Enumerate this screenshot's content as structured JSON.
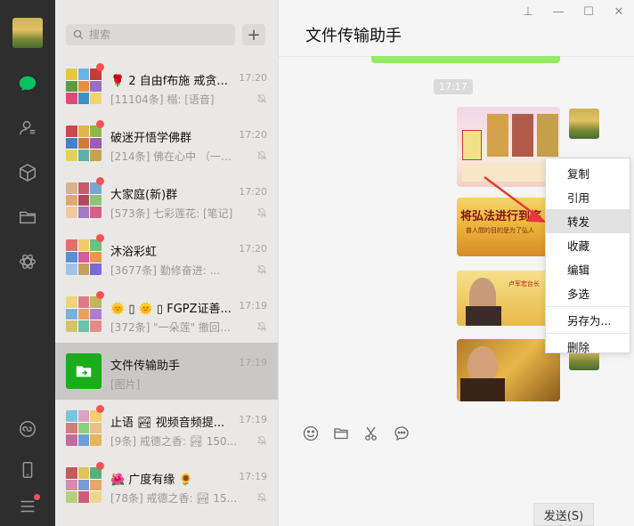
{
  "rail": {
    "icons": [
      "chat-icon",
      "contacts-icon",
      "favorites-icon",
      "files-icon",
      "moments-icon",
      "miniprogram-icon",
      "phone-icon",
      "menu-icon"
    ]
  },
  "search": {
    "placeholder": "搜索"
  },
  "chats": [
    {
      "name": "🌹 2 自由f布施 戒贪...",
      "time": "17:20",
      "preview": "[11104条] 榻: [语音]"
    },
    {
      "name": "破迷开悟学佛群",
      "time": "17:20",
      "preview": "[214条] 佛在心中 （一门..."
    },
    {
      "name": "大家庭(新)群",
      "time": "17:20",
      "preview": "[573条] 七彩莲花: [笔记]"
    },
    {
      "name": "沐浴彩虹",
      "time": "17:20",
      "preview": "[3677条] 勤修奋进: ..."
    },
    {
      "name": "🌞 ▯ 🌞 ▯ FGPZ证善...",
      "time": "17:19",
      "preview": "[372条] \"一朵莲\" 撤回了..."
    },
    {
      "name": "文件传输助手",
      "time": "17:19",
      "preview": "[图片]"
    },
    {
      "name": "止语 🏞 视频音频提...",
      "time": "17:19",
      "preview": "[9条] 戒德之香: 🏞 150..."
    },
    {
      "name": "🌺 广度有缘 🌻",
      "time": "17:19",
      "preview": "[78条] 戒德之香: 🏞 15..."
    }
  ],
  "chat": {
    "title": "文件传输助手",
    "timestamp": "17:17",
    "image1_text": "将弘法进行到底",
    "image1_sub": "普人間的目的是为了弘人",
    "image2_title": "卢军宏台长",
    "send_label": "发送(S)"
  },
  "context_menu": [
    "复制",
    "引用",
    "转发",
    "收藏",
    "编辑",
    "多选",
    "另存为...",
    "删除"
  ],
  "window_controls": [
    "pin",
    "minimize",
    "maximize",
    "close"
  ],
  "colors": {
    "accent_green": "#1aad19",
    "badge_red": "#fa5151",
    "bubble_green": "#95ec69"
  }
}
